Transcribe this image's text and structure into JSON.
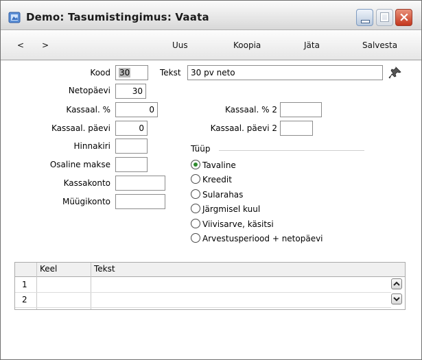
{
  "window": {
    "title": "Demo: Tasumistingimus: Vaata"
  },
  "toolbar": {
    "prev": "<",
    "next": ">",
    "new": "Uus",
    "copy": "Koopia",
    "cancel": "Jäta",
    "save": "Salvesta"
  },
  "form": {
    "code_label": "Kood",
    "code_value": "30",
    "text_label": "Tekst",
    "text_value": "30 pv neto",
    "net_days_label": "Netopäevi",
    "net_days_value": "30",
    "cash_disc_label": "Kassaal. %",
    "cash_disc_value": "0",
    "cash_disc2_label": "Kassaal. % 2",
    "cash_disc2_value": "",
    "cash_days_label": "Kassaal. päevi",
    "cash_days_value": "0",
    "cash_days2_label": "Kassaal. päevi 2",
    "cash_days2_value": "",
    "price_list_label": "Hinnakiri",
    "price_list_value": "",
    "partial_payment_label": "Osaline makse",
    "partial_payment_value": "",
    "cash_account_label": "Kassakonto",
    "cash_account_value": "",
    "sales_account_label": "Müügikonto",
    "sales_account_value": ""
  },
  "type_group": {
    "legend": "Tüüp",
    "selected": 0,
    "options": [
      "Tavaline",
      "Kreedit",
      "Sularahas",
      "Järgmisel kuul",
      "Viivisarve, käsitsi",
      "Arvestusperiood + netopäevi"
    ]
  },
  "grid": {
    "columns": [
      "Keel",
      "Tekst"
    ],
    "rows": [
      {
        "num": "1",
        "keel": "",
        "tekst": ""
      },
      {
        "num": "2",
        "keel": "",
        "tekst": ""
      }
    ]
  },
  "colors": {
    "selected_radio": "#2e8b2e",
    "close_button": "#c4371d"
  }
}
